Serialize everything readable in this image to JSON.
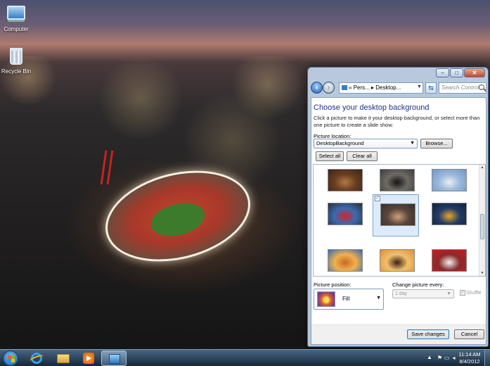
{
  "desktop": {
    "icons": [
      {
        "label": "Computer",
        "icon": "computer-icon"
      },
      {
        "label": "Recycle Bin",
        "icon": "recycle-bin-icon"
      }
    ]
  },
  "window": {
    "breadcrumb": "« Pers... ▸ Desktop...",
    "search_placeholder": "Search Control...",
    "title": "Choose your desktop background",
    "description": "Click a picture to make it your desktop background, or select more than one picture to create a slide show.",
    "picture_location_label": "Picture location:",
    "picture_location_value": "DesktopBackground",
    "browse_label": "Browse...",
    "select_all_label": "Select all",
    "clear_all_label": "Clear all",
    "thumbnails": [
      {
        "name": "westminster-hall",
        "checked": false,
        "colors": [
          "#3a2418",
          "#b07a42",
          "#6a3e22"
        ]
      },
      {
        "name": "downing-street-door",
        "checked": false,
        "colors": [
          "#3e3c3a",
          "#151515",
          "#6e6a64"
        ]
      },
      {
        "name": "wembley-stadium",
        "checked": false,
        "colors": [
          "#6d97c9",
          "#eaeef4",
          "#9bb8da"
        ]
      },
      {
        "name": "underground-sign",
        "checked": false,
        "colors": [
          "#2b2c3a",
          "#d4232a",
          "#3a6bb0"
        ]
      },
      {
        "name": "olympic-stadium-aerial",
        "checked": true,
        "colors": [
          "#332e2c",
          "#c9a27c",
          "#5b463c"
        ]
      },
      {
        "name": "taxi-at-night",
        "checked": false,
        "colors": [
          "#10213c",
          "#e8a52a",
          "#233c66"
        ]
      },
      {
        "name": "royal-albert-hall",
        "checked": false,
        "colors": [
          "#2f68b7",
          "#c9692b",
          "#f3b04c"
        ]
      },
      {
        "name": "big-ben-sunset",
        "checked": false,
        "colors": [
          "#e08a32",
          "#3b1f18",
          "#f2c06a"
        ]
      },
      {
        "name": "red-bus-big-ben",
        "checked": false,
        "colors": [
          "#c81e1e",
          "#f2f2f2",
          "#8a2a2a"
        ]
      }
    ],
    "picture_position_label": "Picture position:",
    "picture_position_value": "Fill",
    "change_every_label": "Change picture every:",
    "change_every_value": "1 day",
    "shuffle_label": "Shuffle",
    "save_label": "Save changes",
    "cancel_label": "Cancel"
  },
  "taskbar": {
    "pinned": [
      {
        "name": "internet-explorer"
      },
      {
        "name": "windows-explorer"
      },
      {
        "name": "media-player"
      },
      {
        "name": "control-panel",
        "active": true
      }
    ],
    "time": "11:14 AM",
    "date": "8/4/2012"
  }
}
